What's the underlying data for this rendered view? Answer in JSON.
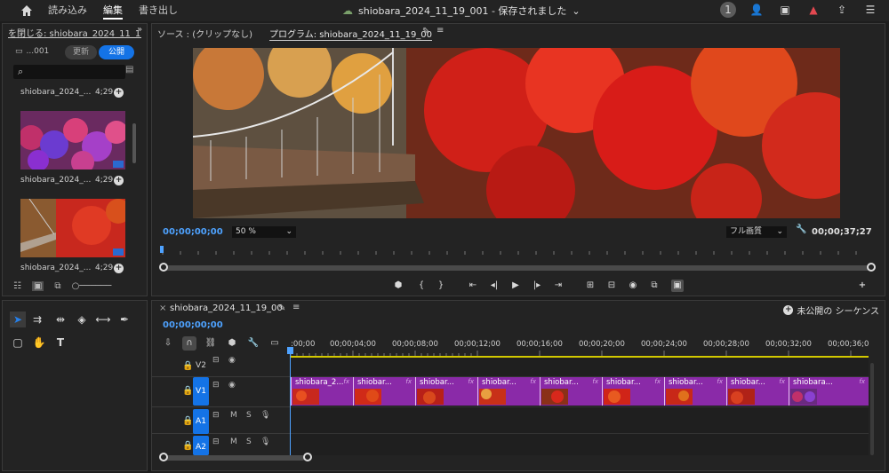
{
  "topbar": {
    "nav": [
      "読み込み",
      "編集",
      "書き出し"
    ],
    "active_nav": "編集",
    "project_title": "shiobara_2024_11_19_001 - 保存されました",
    "notification_count": "1"
  },
  "project_panel": {
    "tab_title": "を閉じる: shiobara_2024_11_19",
    "bin_name": "...001",
    "update_button": "更新",
    "publish_button": "公開",
    "clips": [
      {
        "name": "shiobara_2024_...",
        "duration": "4;29"
      },
      {
        "name": "shiobara_2024_...",
        "duration": "4;29"
      },
      {
        "name": "shiobara_2024_...",
        "duration": "4;29"
      }
    ]
  },
  "program_monitor": {
    "source_tab": "ソース : (クリップなし)",
    "program_tab": "プログラム: shiobara_2024_11_19_00",
    "current_timecode": "00;00;00;00",
    "zoom": "50 %",
    "quality": "フル画質",
    "duration_timecode": "00;00;37;27"
  },
  "timeline": {
    "sequence_tab": "shiobara_2024_11_19_00",
    "unpublished_sequence": "未公開の シーケンス",
    "current_timecode": "00;00;00;00",
    "ruler_labels": [
      ":00;00",
      "00;00;04;00",
      "00;00;08;00",
      "00;00;12;00",
      "00;00;16;00",
      "00;00;20;00",
      "00;00;24;00",
      "00;00;28;00",
      "00;00;32;00",
      "00;00;36;0"
    ],
    "tracks": [
      {
        "name": "V2",
        "type": "video"
      },
      {
        "name": "V1",
        "type": "video"
      },
      {
        "name": "A1",
        "type": "audio"
      },
      {
        "name": "A2",
        "type": "audio"
      }
    ],
    "track_m": "M",
    "track_s": "S",
    "clips": [
      "shiobara_2...",
      "shiobar...",
      "shiobar...",
      "shiobar...",
      "shiobar...",
      "shiobar...",
      "shiobar...",
      "shiobar...",
      "shiobara..."
    ],
    "fx_label": "fx"
  },
  "colors": {
    "accent": "#1473e6",
    "timecode": "#4ea2ff",
    "clip": "#8a2aa8",
    "warning": "#e34850"
  }
}
